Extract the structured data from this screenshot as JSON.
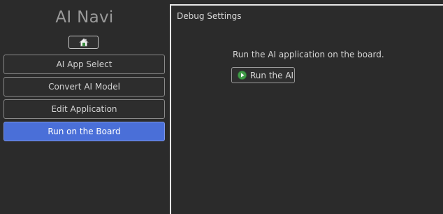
{
  "sidebar": {
    "title": "AI Navi",
    "home_icon": "home-icon",
    "items": [
      {
        "label": "AI App Select",
        "active": false
      },
      {
        "label": "Convert AI Model",
        "active": false
      },
      {
        "label": "Edit Application",
        "active": false
      },
      {
        "label": "Run on the Board",
        "active": true
      }
    ]
  },
  "main": {
    "title": "Debug Settings",
    "description": "Run the AI application on the board.",
    "run_button": {
      "label": "Run the AI",
      "icon": "play-icon"
    }
  },
  "colors": {
    "background": "#2b2b2b",
    "active_nav": "#4a6fd8",
    "play_icon": "#3f9a46"
  }
}
